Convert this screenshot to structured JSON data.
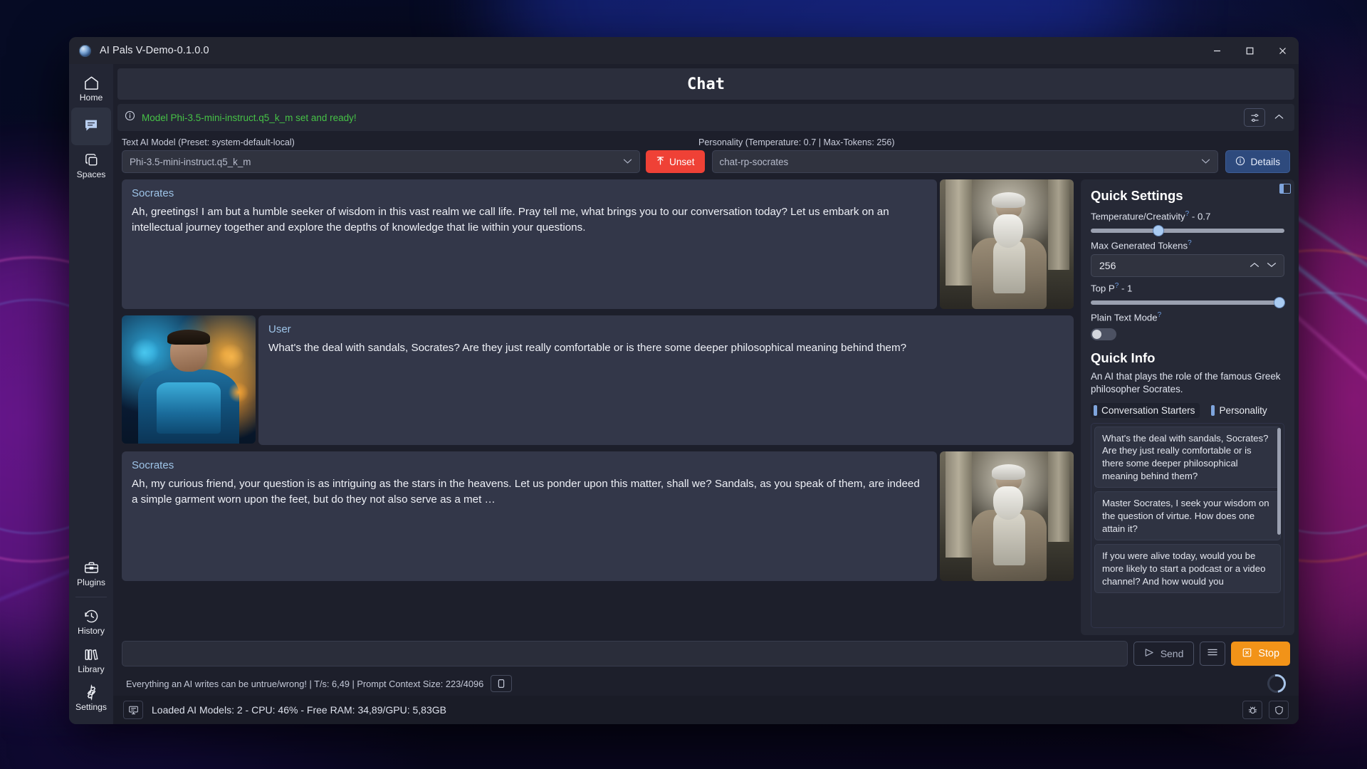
{
  "window": {
    "title": "AI Pals V-Demo-0.1.0.0",
    "controls": {
      "minimize": "minimize-icon",
      "maximize": "maximize-icon",
      "close": "close-icon"
    }
  },
  "sidebar": {
    "top_items": [
      {
        "label": "Home",
        "icon": "home-icon",
        "active": false
      },
      {
        "label": "",
        "icon": "chat-bubble-icon",
        "active": true
      },
      {
        "label": "Spaces",
        "icon": "spaces-stack-icon",
        "active": false
      }
    ],
    "bottom_items": [
      {
        "label": "Plugins",
        "icon": "toolbox-icon"
      },
      {
        "label": "History",
        "icon": "clock-history-icon"
      },
      {
        "label": "Library",
        "icon": "books-icon"
      },
      {
        "label": "Settings",
        "icon": "gear-icon"
      }
    ]
  },
  "page": {
    "title": "Chat"
  },
  "status_strip": {
    "message": "Model Phi-3.5-mini-instruct.q5_k_m set and ready!",
    "message_color": "#46c246",
    "info_icon": "info-circle-icon",
    "settings_icon": "sliders-icon",
    "collapse_icon": "chevron-up-icon"
  },
  "selectors": {
    "model_label": "Text AI Model (Preset: system-default-local)",
    "model_value": "Phi-3.5-mini-instruct.q5_k_m",
    "unset_label": "Unset",
    "unset_icon": "upload-arrow-icon",
    "unset_color": "#ef4136",
    "personality_label": "Personality (Temperature:  0.7 | Max-Tokens:  256)",
    "personality_value": "chat-rp-socrates",
    "details_label": "Details",
    "details_icon": "info-circle-icon"
  },
  "chat": {
    "messages": [
      {
        "role": "assistant",
        "who": "Socrates",
        "text": "Ah, greetings! I am but a humble seeker of wisdom in this vast realm we call life. Pray tell me, what brings you to our conversation today? Let us embark on an intellectual journey together and explore the depths of knowledge that lie within your questions.",
        "avatar": "socrates-avatar",
        "avatar_side": "right"
      },
      {
        "role": "user",
        "who": "User",
        "text": "What's the deal with sandals, Socrates? Are they just really comfortable or is there some deeper philosophical meaning behind them?",
        "avatar": "user-avatar",
        "avatar_side": "left"
      },
      {
        "role": "assistant",
        "who": "Socrates",
        "text": "Ah, my curious friend, your question is as intriguing as the stars in the heavens. Let us ponder upon this matter, shall we? Sandals, as you speak of them, are indeed a simple garment worn upon the feet, but do they not also serve as a met …",
        "avatar": "socrates-avatar",
        "avatar_side": "right"
      }
    ]
  },
  "quick_settings": {
    "heading": "Quick Settings",
    "temperature_label": "Temperature/Creativity",
    "temperature_value": "0.7",
    "temperature_pct": 35,
    "max_tokens_label": "Max Generated Tokens",
    "max_tokens_value": "256",
    "top_p_label": "Top P",
    "top_p_value": "1",
    "top_p_pct": 100,
    "plain_text_label": "Plain Text Mode",
    "plain_text_on": false,
    "help_marker": "?"
  },
  "quick_info": {
    "heading": "Quick Info",
    "description": "An AI that plays the role of the famous Greek philosopher Socrates.",
    "tabs": [
      {
        "label": "Conversation Starters",
        "active": true
      },
      {
        "label": "Personality",
        "active": false
      }
    ],
    "starters": [
      "What's the deal with sandals, Socrates? Are they just really comfortable or is there some deeper philosophical meaning behind them?",
      "Master Socrates, I seek your wisdom on the question of virtue. How does one attain it?",
      "If you were alive today, would you be more likely to start a podcast or a video channel? And how would you"
    ]
  },
  "composer": {
    "input_value": "",
    "input_placeholder": "",
    "send_label": "Send",
    "send_icon": "send-arrow-icon",
    "menu_icon": "hamburger-icon",
    "stop_label": "Stop",
    "stop_icon": "stop-square-icon",
    "stop_color": "#f29318",
    "loading_icon": "spinner-icon"
  },
  "disclaimer": {
    "text": "Everything an AI writes can be untrue/wrong! | T/s: 6,49 | Prompt Context Size: 223/4096",
    "copy_icon": "copy-icon"
  },
  "statusbar": {
    "monitor_icon": "server-monitor-icon",
    "text": "Loaded AI Models: 2 - CPU: 46% - Free RAM: 34,89/GPU: 5,83GB",
    "right_icons": [
      "bug-icon",
      "shield-icon"
    ]
  }
}
